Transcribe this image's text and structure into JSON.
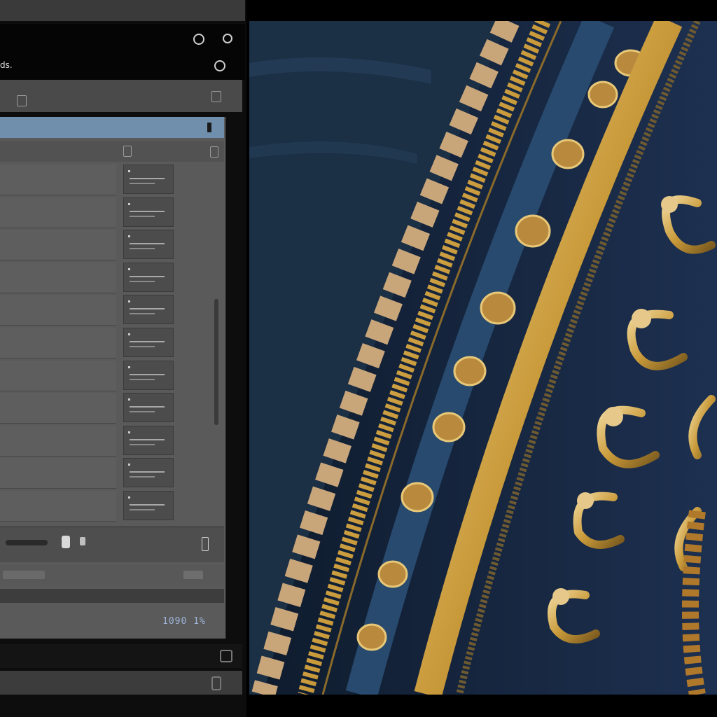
{
  "colors": {
    "title_bar": "#6f8fad",
    "panel_bg": "#5a5a5a",
    "water": "#1b2f45",
    "gold": "#c99a3a"
  },
  "header": {
    "title": "ds.",
    "icons": [
      "info-icon",
      "gear-icon",
      "record-icon"
    ]
  },
  "counter": "1090 1%",
  "rows_count_visible": 11,
  "photo": {
    "subject": "ornate-gilded-frame"
  }
}
